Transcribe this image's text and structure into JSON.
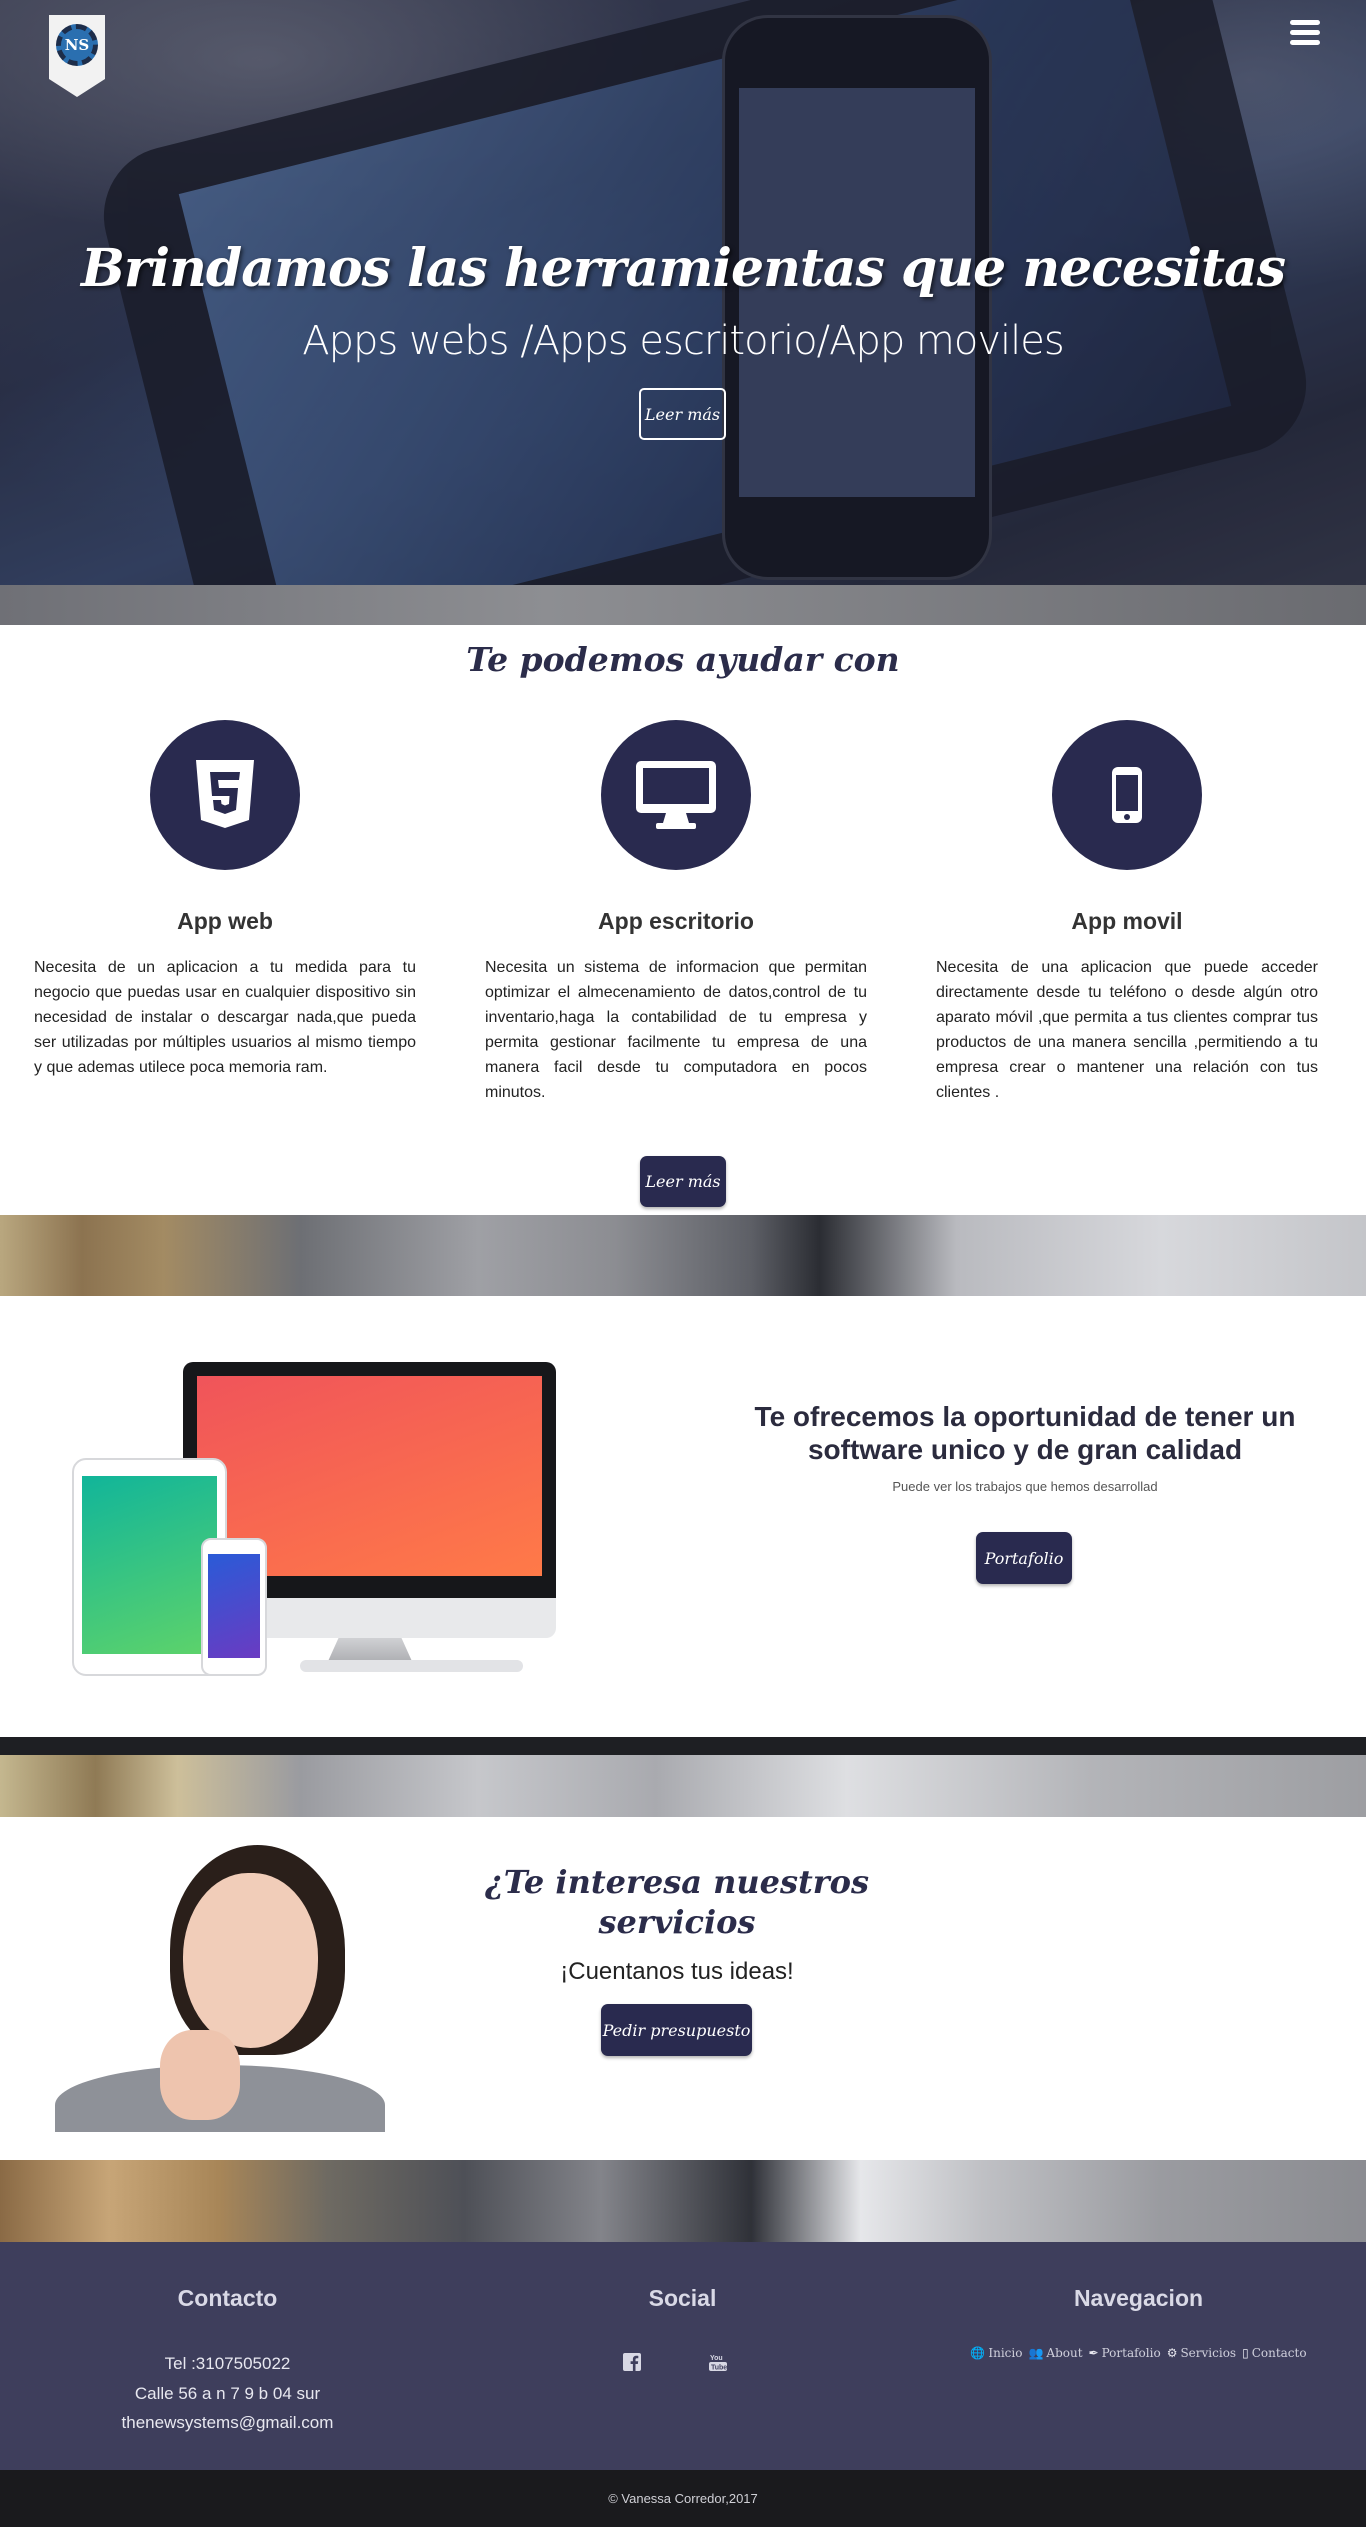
{
  "header": {
    "logo_text": "NS",
    "menu_icon": "hamburger-menu-icon"
  },
  "hero": {
    "title": "Brindamos las herramientas que necesitas",
    "subtitle": "Apps webs /Apps escritorio/App moviles",
    "button_label": "Leer más"
  },
  "services": {
    "title": "Te podemos ayudar con",
    "items": [
      {
        "icon": "html5-icon",
        "title": "App web",
        "text": "Necesita de un aplicacion a tu medida para tu negocio que puedas usar en cualquier dispositivo sin necesidad de instalar o descargar nada,que pueda ser utilizadas por múltiples usuarios al mismo tiempo y que ademas utilece poca memoria ram."
      },
      {
        "icon": "desktop-icon",
        "title": "App escritorio",
        "text": "Necesita un sistema de informacion que permitan optimizar el almecenamiento de datos,control de tu inventario,haga la contabilidad de tu empresa y permita gestionar facilmente tu empresa de una manera facil desde tu computadora en pocos minutos."
      },
      {
        "icon": "mobile-icon",
        "title": "App movil",
        "text": "Necesita de una aplicacion que puede acceder directamente desde tu teléfono o desde algún otro aparato móvil ,que permita a tus clientes comprar tus productos de una manera sencilla ,permitiendo a tu empresa crear o mantener una relación con tus clientes ."
      }
    ],
    "button_label": "Leer más"
  },
  "offer": {
    "title": "Te ofrecemos la oportunidad de tener un software unico y de gran calidad",
    "subtitle": "Puede ver los trabajos que hemos desarrollad",
    "button_label": "Portafolio"
  },
  "interest": {
    "title": "¿Te interesa nuestros servicios",
    "subtitle": "¡Cuentanos tus ideas!",
    "button_label": "Pedir presupuesto"
  },
  "footer": {
    "contact": {
      "title": "Contacto",
      "phone": "Tel :3107505022",
      "address": "Calle 56 a n 7 9 b 04 sur",
      "email": "thenewsystems@gmail.com"
    },
    "social": {
      "title": "Social",
      "icons": [
        "facebook-icon",
        "youtube-icon"
      ]
    },
    "navigation": {
      "title": "Navegacion",
      "items": [
        {
          "icon": "globe-icon",
          "label": "Inicio"
        },
        {
          "icon": "users-icon",
          "label": "About"
        },
        {
          "icon": "brush-icon",
          "label": "Portafolio"
        },
        {
          "icon": "cogs-icon",
          "label": "Servicios"
        },
        {
          "icon": "mobile-icon",
          "label": "Contacto"
        }
      ]
    },
    "copyright": "© Vanessa Corredor,2017"
  },
  "colors": {
    "primary_dark": "#292a4f",
    "footer_bg": "#3e3e5c",
    "copyright_bg": "#1a1a1d"
  }
}
